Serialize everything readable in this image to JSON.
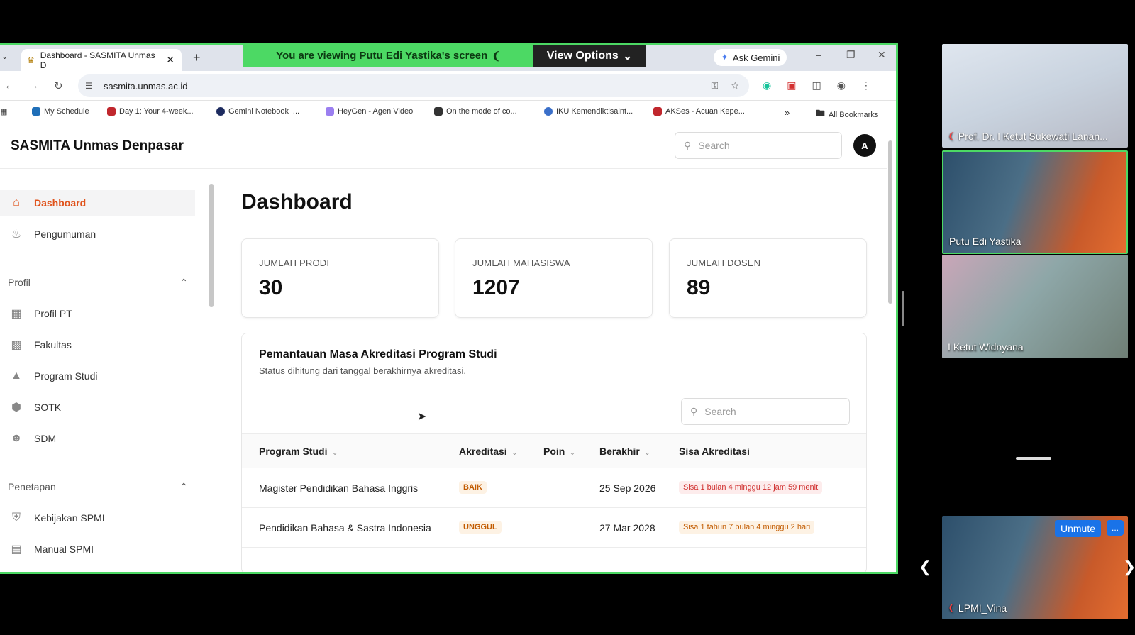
{
  "browser": {
    "tab_title": "Dashboard - SASMITA Unmas D",
    "url": "sasmita.unmas.ac.id",
    "ask_gemini": "Ask Gemini",
    "bookmarks": [
      "My Schedule",
      "Day 1: Your 4-week...",
      "Gemini Notebook |...",
      "HeyGen - Agen Video",
      "On the mode of co...",
      "IKU Kemendiktisaint...",
      "AKSes - Acuan Kepe..."
    ],
    "all_bookmarks": "All Bookmarks"
  },
  "share": {
    "banner": "You are viewing  Putu Edi Yastika's screen",
    "view_options": "View Options"
  },
  "app": {
    "title": "SASMITA Unmas Denpasar",
    "search_placeholder": "Search",
    "avatar_letter": "A"
  },
  "sidebar": {
    "items": [
      {
        "label": "Dashboard",
        "icon": "home-icon"
      },
      {
        "label": "Pengumuman",
        "icon": "bell-icon"
      }
    ],
    "profil_label": "Profil",
    "profil_items": [
      {
        "label": "Profil PT",
        "icon": "building-icon"
      },
      {
        "label": "Fakultas",
        "icon": "office-icon"
      },
      {
        "label": "Program Studi",
        "icon": "graduation-icon"
      },
      {
        "label": "SOTK",
        "icon": "cube-icon"
      },
      {
        "label": "SDM",
        "icon": "users-icon"
      }
    ],
    "penetapan_label": "Penetapan",
    "penetapan_items": [
      {
        "label": "Kebijakan SPMI",
        "icon": "shield-icon"
      },
      {
        "label": "Manual SPMI",
        "icon": "book-icon"
      }
    ]
  },
  "main": {
    "title": "Dashboard",
    "cards": [
      {
        "label": "JUMLAH PRODI",
        "value": "30"
      },
      {
        "label": "JUMLAH MAHASISWA",
        "value": "1207"
      },
      {
        "label": "JUMLAH DOSEN",
        "value": "89"
      }
    ],
    "panel": {
      "title": "Pemantauan Masa Akreditasi Program Studi",
      "subtitle": "Status dihitung dari tanggal berakhirnya akreditasi.",
      "search_placeholder": "Search",
      "columns": [
        "Program Studi",
        "Akreditasi",
        "Poin",
        "Berakhir",
        "Sisa Akreditasi"
      ],
      "rows": [
        {
          "prodi": "Magister Pendidikan Bahasa Inggris",
          "akreditasi": "BAIK",
          "poin": "",
          "berakhir": "25 Sep 2026",
          "sisa": "Sisa 1 bulan 4 minggu 12 jam 59 menit",
          "sisa_color": "#d0302f",
          "sisa_bg": "#fdecec"
        },
        {
          "prodi": "Pendidikan Bahasa & Sastra Indonesia",
          "akreditasi": "UNGGUL",
          "poin": "",
          "berakhir": "27 Mar 2028",
          "sisa": "Sisa 1 tahun 7 bulan 4 minggu 2 hari",
          "sisa_color": "#c25b00",
          "sisa_bg": "#fdf2e4"
        }
      ]
    }
  },
  "participants": [
    {
      "name": "Prof. Dr. I Ketut Sukewati Lanan...",
      "muted": true
    },
    {
      "name": "Putu Edi Yastika",
      "muted": false
    },
    {
      "name": "I Ketut Widnyana",
      "muted": false
    },
    {
      "name": "LPMI_Vina",
      "muted": true
    }
  ],
  "meeting": {
    "unmute": "Unmute",
    "more": "..."
  }
}
